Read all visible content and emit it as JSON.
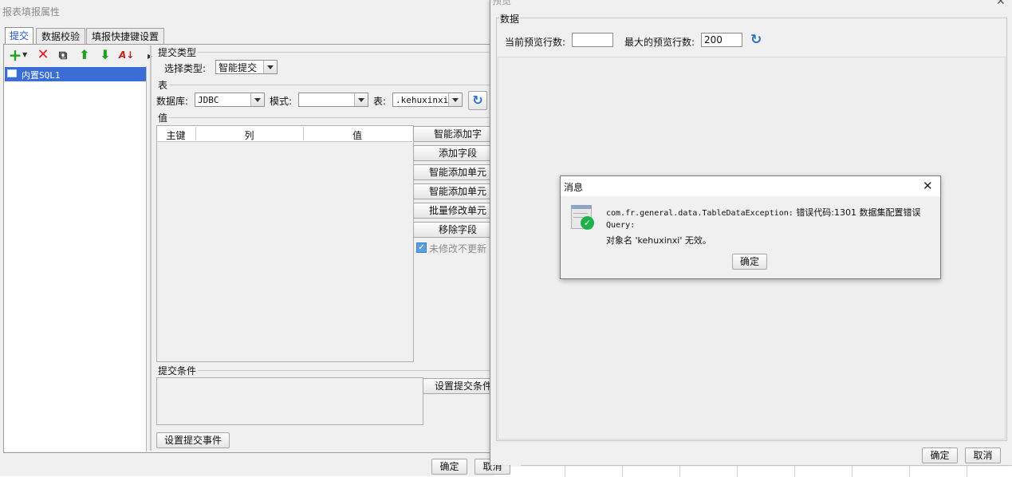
{
  "left_window": {
    "title": "报表填报属性",
    "tabs": [
      "提交",
      "数据校验",
      "填报快捷键设置"
    ],
    "tree_item": "内置SQL1",
    "section_submit_type": "提交类型",
    "select_type_label": "选择类型:",
    "select_type_value": "智能提交",
    "section_table": "表",
    "database_label": "数据库:",
    "database_value": "JDBC",
    "schema_label": "模式:",
    "schema_value": "",
    "table_label": "表:",
    "table_value": ".kehuxinxi",
    "section_value": "值",
    "columns": [
      "主键",
      "列",
      "值"
    ],
    "side_buttons": [
      "智能添加字",
      "添加字段",
      "智能添加单元",
      "智能添加单元",
      "批量修改单元",
      "移除字段"
    ],
    "checkbox_label": "未修改不更新",
    "section_condition": "提交条件",
    "set_condition_button": "设置提交条件",
    "set_event_button": "设置提交事件",
    "ok_button": "确定",
    "cancel_button": "取消"
  },
  "right_window": {
    "title": "预览",
    "section_data": "数据",
    "current_rows_label": "当前预览行数:",
    "current_rows_value": "",
    "max_rows_label": "最大的预览行数:",
    "max_rows_value": "200",
    "ok_button": "确定",
    "cancel_button": "取消"
  },
  "message_dialog": {
    "title": "消息",
    "line1_prefix": "com.fr.general.data.TableDataException:",
    "line1_suffix": "错误代码:1301 数据集配置错误",
    "line2": "Query:",
    "line3": "对象名 'kehuxinxi' 无效。",
    "ok_button": "确定"
  },
  "colors": {
    "selection": "#3a6ed6",
    "refresh_blue": "#2a73c9",
    "add_green": "#1fa01f",
    "delete_red": "#e02020",
    "check_green": "#1fb14a"
  }
}
